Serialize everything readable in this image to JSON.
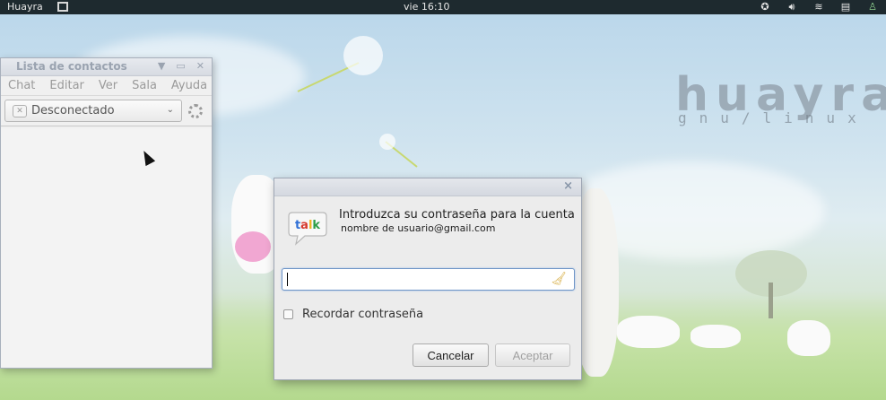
{
  "topbar": {
    "activities_label": "Huayra",
    "clock": "vie 16:10",
    "tray_icons": [
      "accessibility-icon",
      "volume-icon",
      "wifi-icon",
      "clipboard-icon",
      "user-icon"
    ]
  },
  "desktop": {
    "logo_main": "huayra",
    "logo_sub": "gnu/linux"
  },
  "contacts_window": {
    "title": "Lista de contactos",
    "menu": [
      "Chat",
      "Editar",
      "Ver",
      "Sala",
      "Ayuda"
    ],
    "status": "Desconectado"
  },
  "dialog": {
    "prompt_line1": "Introduzca su contraseña para la cuenta",
    "prompt_line2": "nombre de usuario@gmail.com",
    "icon_text": "talk",
    "password_value": "",
    "remember_label": "Recordar contraseña",
    "remember_checked": false,
    "cancel_label": "Cancelar",
    "accept_label": "Aceptar"
  },
  "colors": {
    "topbar_bg": "#1e2a2f",
    "focus_border": "#6f95c7"
  }
}
